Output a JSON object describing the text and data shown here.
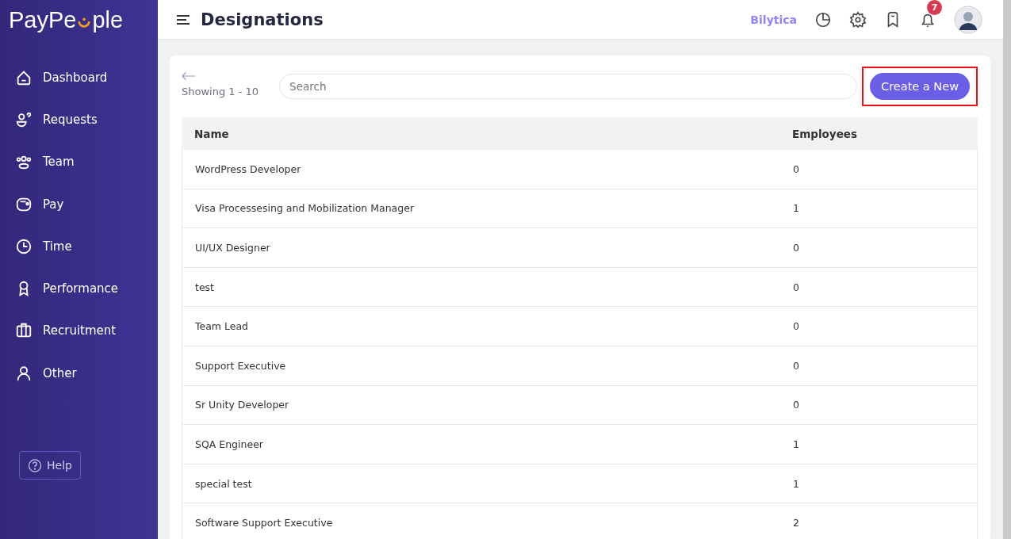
{
  "logo": {
    "text_start": "PayPe",
    "text_end": "ple"
  },
  "sidebar": {
    "items": [
      {
        "label": "Dashboard",
        "selected": false
      },
      {
        "label": "Requests",
        "selected": false
      },
      {
        "label": "Team",
        "selected": false
      },
      {
        "label": "Pay",
        "selected": false
      },
      {
        "label": "Time",
        "selected": false
      },
      {
        "label": "Performance",
        "selected": false
      },
      {
        "label": "Recruitment",
        "selected": false
      },
      {
        "label": "Other",
        "selected": false
      }
    ],
    "help": "Help"
  },
  "header": {
    "title": "Designations",
    "company": "Bilytica",
    "notification_count": "7"
  },
  "toolbar": {
    "showing": "Showing 1 - 10",
    "search": {
      "placeholder": "Search"
    },
    "create_button": {
      "label": "Create a New",
      "highlighted": true
    }
  },
  "table": {
    "columns": [
      "Name",
      "Employees"
    ],
    "rows": [
      [
        "WordPress Developer",
        "0"
      ],
      [
        "Visa Processesing and Mobilization Manager",
        "1"
      ],
      [
        "UI/UX Designer",
        "0"
      ],
      [
        "test",
        "0"
      ],
      [
        "Team Lead",
        "0"
      ],
      [
        "Support Executive",
        "0"
      ],
      [
        "Sr Unity Developer",
        "0"
      ],
      [
        "SQA Engineer",
        "1"
      ],
      [
        "special test",
        "1"
      ],
      [
        "Software Support Executive",
        "2"
      ]
    ]
  }
}
